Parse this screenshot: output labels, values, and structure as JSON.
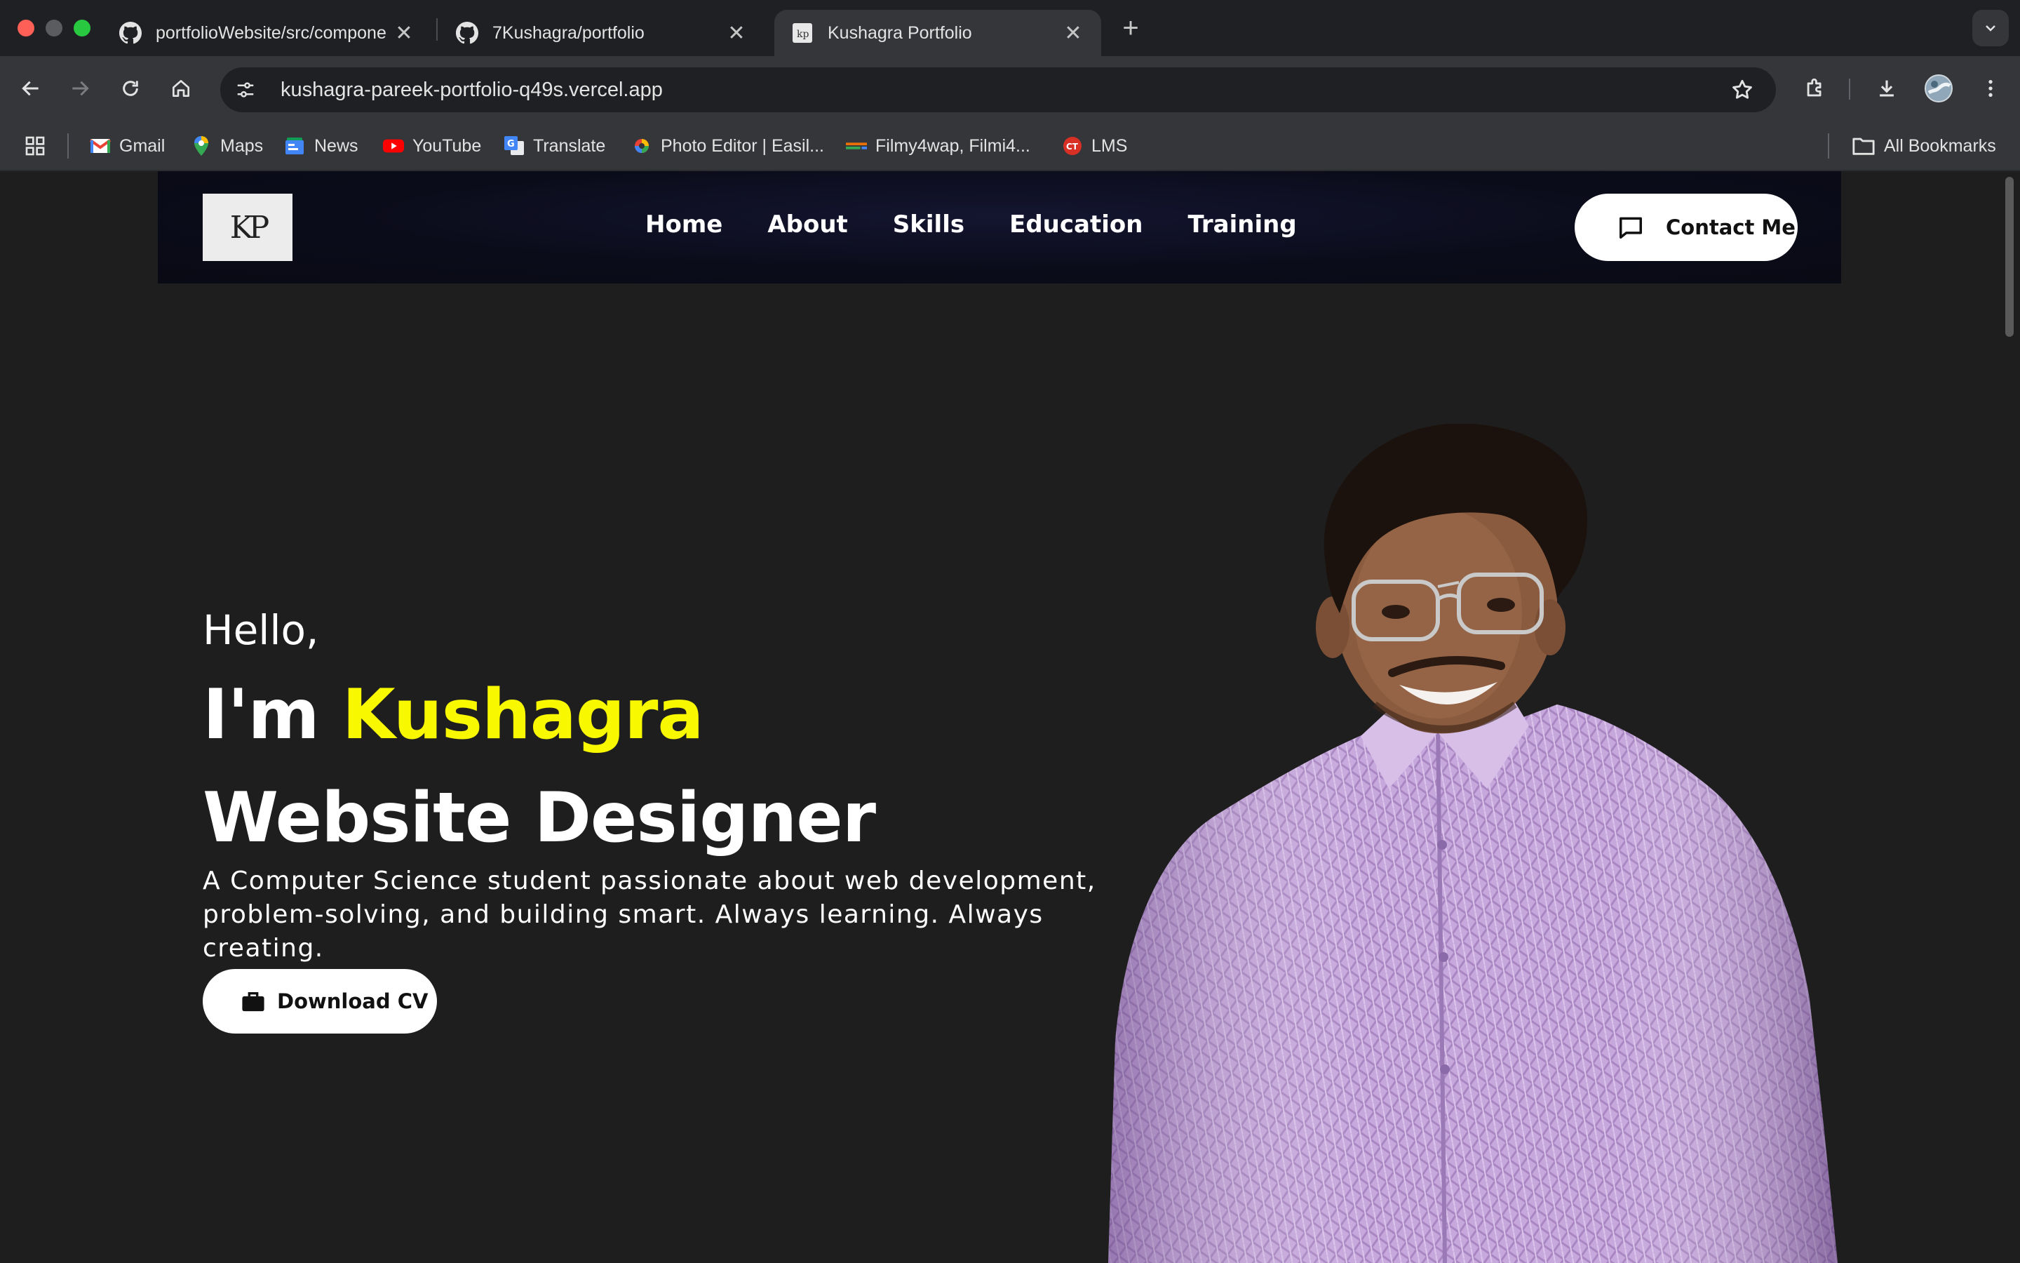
{
  "browser": {
    "tabs": [
      {
        "title": "portfolioWebsite/src/compone",
        "icon": "github-icon",
        "active": false
      },
      {
        "title": "7Kushagra/portfolio",
        "icon": "github-icon",
        "active": false
      },
      {
        "title": "Kushagra Portfolio",
        "icon": "kp-favicon",
        "active": true
      }
    ],
    "close_glyph": "✕",
    "new_tab_glyph": "+",
    "url": "kushagra-pareek-portfolio-q49s.vercel.app",
    "bookmarks": [
      {
        "label": "Gmail",
        "icon": "gmail-icon",
        "color": "#ea4335"
      },
      {
        "label": "Maps",
        "icon": "maps-icon",
        "color": "#34a853"
      },
      {
        "label": "News",
        "icon": "news-icon",
        "color": "#4285f4"
      },
      {
        "label": "YouTube",
        "icon": "youtube-icon",
        "color": "#ff0000"
      },
      {
        "label": "Translate",
        "icon": "translate-icon",
        "color": "#4285f4"
      },
      {
        "label": "Photo Editor | Easil...",
        "icon": "photo-editor-icon",
        "color": "#fbbc05"
      },
      {
        "label": "Filmy4wap, Filmi4...",
        "icon": "filmy-icon",
        "color": "#e8710a"
      },
      {
        "label": "LMS",
        "icon": "lms-icon",
        "color": "#d93025"
      }
    ],
    "all_bookmarks_label": "All Bookmarks"
  },
  "site": {
    "logo_text": "KP",
    "nav": [
      "Home",
      "About",
      "Skills",
      "Education",
      "Training"
    ],
    "contact_label": "Contact Me",
    "hero": {
      "greeting": "Hello,",
      "im_prefix": "I'm ",
      "name": "Kushagra",
      "role": "Website Designer",
      "bio": "A Computer Science student passionate about web development, problem-solving, and building smart. Always learning. Always creating.",
      "cv_label": "Download CV"
    },
    "colors": {
      "accent": "#f8f800",
      "background": "#1e1e1e",
      "navbar": "#0b0c1a"
    }
  }
}
